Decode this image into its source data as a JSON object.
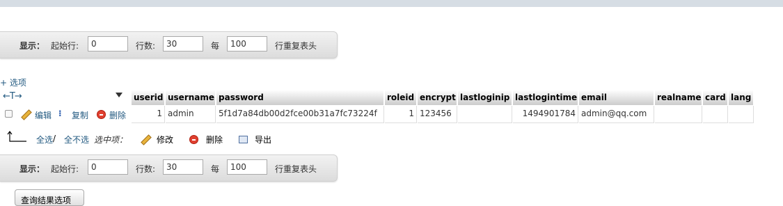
{
  "nav": {
    "show_label": "显示：",
    "start_label": "起始行:",
    "start_value": "0",
    "rows_label": "行数:",
    "rows_value": "30",
    "every_label": "每",
    "every_value": "100",
    "repeat_label": "行重复表头"
  },
  "options_link": "+ 选项",
  "table": {
    "columns": [
      "userid",
      "username",
      "password",
      "roleid",
      "encrypt",
      "lastloginip",
      "lastlogintime",
      "email",
      "realname",
      "card",
      "lang"
    ],
    "row": {
      "edit_label": "编辑",
      "copy_label": "复制",
      "delete_label": "删除",
      "cells": [
        "1",
        "admin",
        "5f1d7a84db00d2fce00b31a7fc73224f",
        "1",
        "123456",
        "",
        "1494901784",
        "admin@qq.com",
        "",
        "",
        ""
      ]
    }
  },
  "bulk": {
    "check_all": "全选",
    "separator": " / ",
    "uncheck_all": "全不选",
    "with_selected": "选中项：",
    "modify": "修改",
    "delete": "删除",
    "export": "导出"
  },
  "query_results_button": "查询结果选项",
  "colors": {
    "link": "#235a81",
    "delete": "#e04030"
  }
}
